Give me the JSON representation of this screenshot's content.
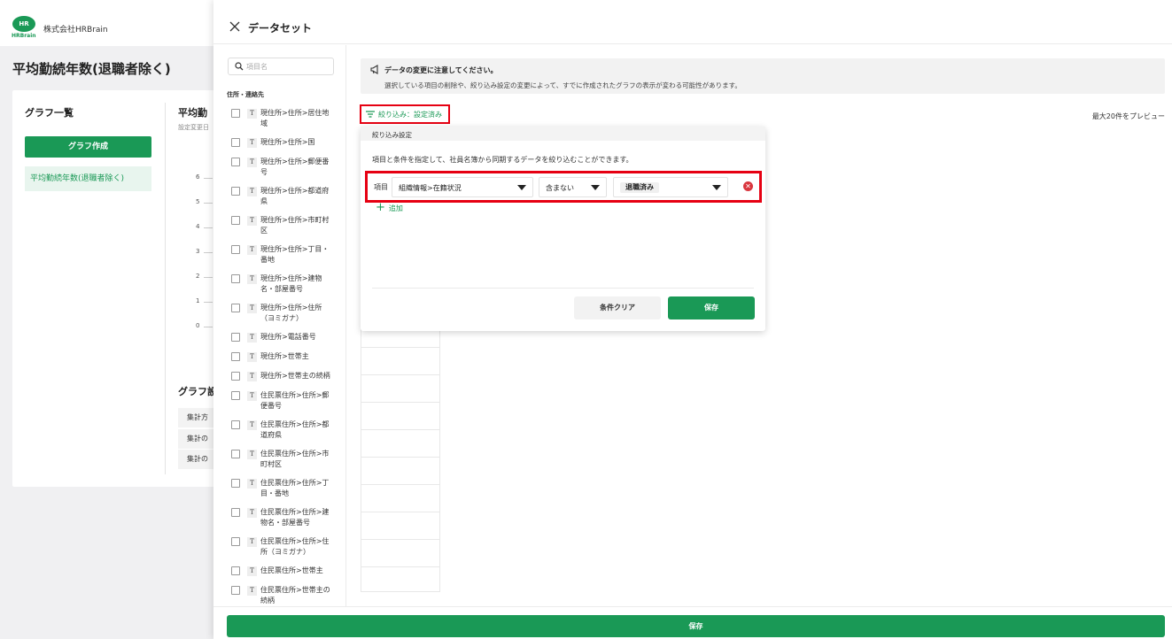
{
  "header": {
    "logo_text": "HR",
    "logo_sub": "HRBrain",
    "company": "株式会社HRBrain"
  },
  "background": {
    "page_title": "平均勤続年数(退職者除く)",
    "graph_list_title": "グラフ一覧",
    "create_graph": "グラフ作成",
    "graph_item": "平均勤続年数(退職者除く)",
    "graph_heading": "平均勤",
    "graph_sub": "設定変更日",
    "y_ticks": [
      "6",
      "5",
      "4",
      "3",
      "2",
      "1",
      "0"
    ],
    "settings_heading": "グラフ設",
    "settings_rows": [
      "集計方",
      "集計の",
      "集計の"
    ]
  },
  "drawer": {
    "title": "データセット",
    "search_placeholder": "項目名",
    "group_label": "住所・連絡先",
    "fields": [
      "現住所>住所>居住地域",
      "現住所>住所>国",
      "現住所>住所>郵便番号",
      "現住所>住所>都道府県",
      "現住所>住所>市町村区",
      "現住所>住所>丁目・番地",
      "現住所>住所>建物名・部屋番号",
      "現住所>住所>住所（ヨミガナ）",
      "現住所>電話番号",
      "現住所>世帯主",
      "現住所>世帯主の続柄",
      "住民票住所>住所>郵便番号",
      "住民票住所>住所>都道府県",
      "住民票住所>住所>市町村区",
      "住民票住所>住所>丁目・番地",
      "住民票住所>住所>建物名・部屋番号",
      "住民票住所>住所>住所（ヨミガナ）",
      "住民票住所>世帯主",
      "住民票住所>世帯主の続柄"
    ],
    "type_icon": "T",
    "notice_title": "データの変更に注意してください。",
    "notice_body": "選択している項目の削除や、絞り込み設定の変更によって、すでに作成されたグラフの表示が変わる可能性があります。",
    "filter_button": "絞り込み：設定済み",
    "preview_note": "最大20件をプレビュー",
    "save": "保存"
  },
  "popup": {
    "title": "絞り込み設定",
    "description": "項目と条件を指定して、社員名簿から同期するデータを絞り込むことができます。",
    "row_label": "項目",
    "field_value": "組織情報>在籍状況",
    "operator_value": "含まない",
    "value_chip": "退職済み",
    "remove_glyph": "✕",
    "add_label": "追加",
    "add_glyph": "+",
    "clear_button": "条件クリア",
    "save_button": "保存"
  },
  "colors": {
    "brand_green": "#1a9956",
    "highlight_red": "#e60012",
    "remove_red": "#d9363e"
  },
  "icons": [
    "close-icon",
    "search-icon",
    "megaphone-icon",
    "filter-icon",
    "caret-down-icon",
    "remove-icon",
    "plus-icon",
    "text-type-icon"
  ]
}
